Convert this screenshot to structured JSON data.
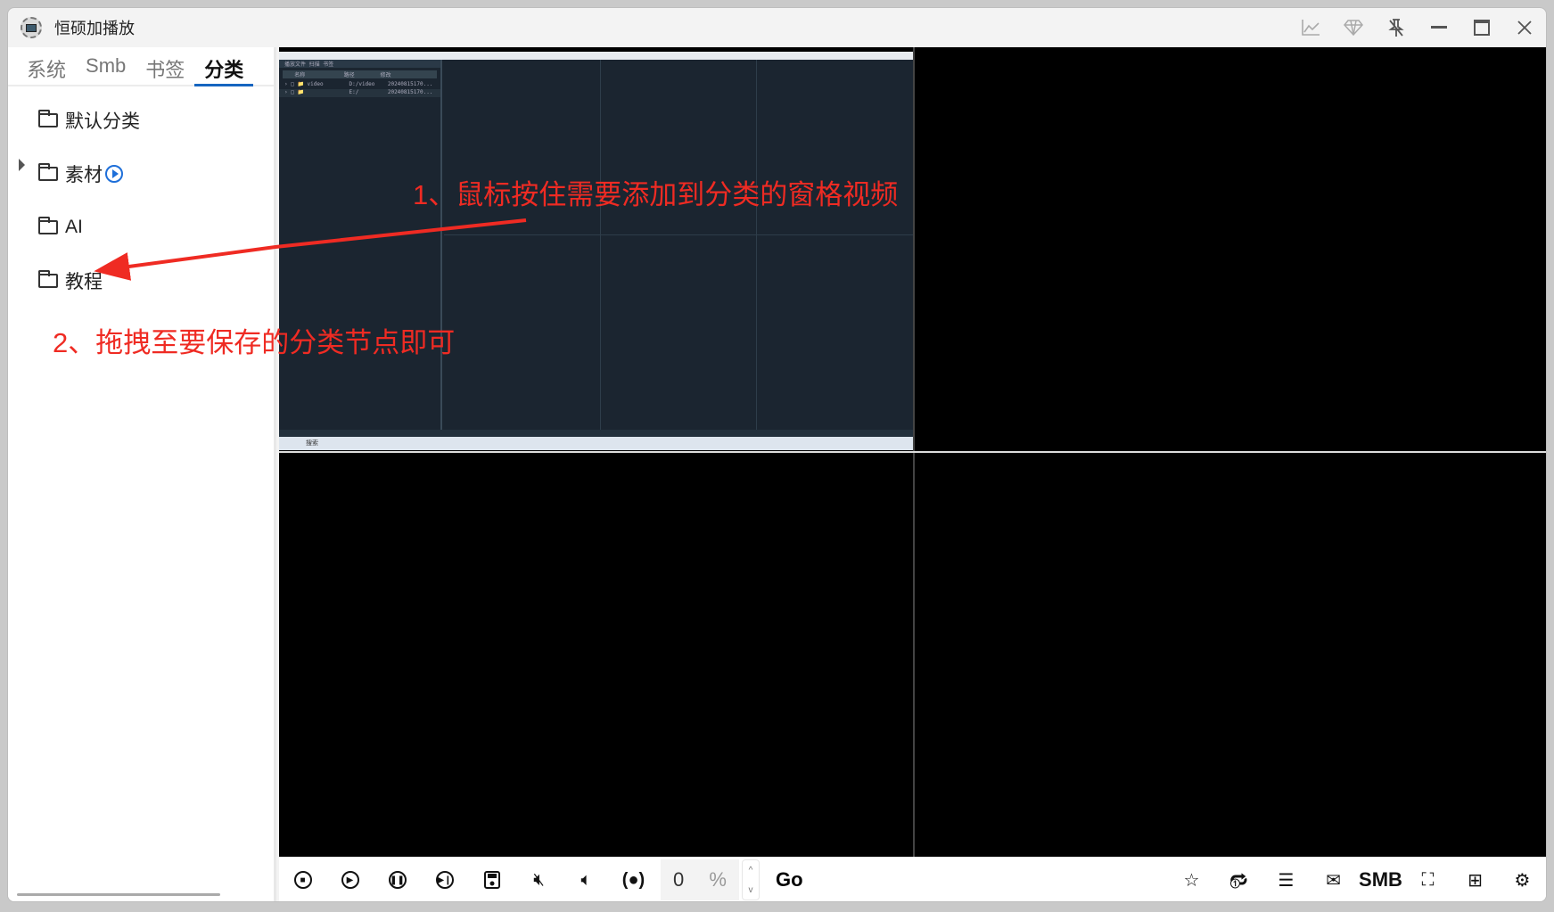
{
  "window": {
    "title": "恒硕加播放",
    "controls": [
      "chart-icon",
      "diamond-icon",
      "unpin-icon",
      "minimize",
      "maximize",
      "close"
    ]
  },
  "sidebar": {
    "tabs": [
      {
        "label": "系统"
      },
      {
        "label": "Smb"
      },
      {
        "label": "书签"
      },
      {
        "label": "分类",
        "active": true
      }
    ],
    "tree": [
      {
        "label": "默认分类"
      },
      {
        "label": "素材",
        "expandable": true,
        "playing": true
      },
      {
        "label": "AI"
      },
      {
        "label": "教程"
      }
    ]
  },
  "embedded": {
    "tabs": "播放文件 扫描 书签",
    "header": "  名称            路径        修改",
    "rows": [
      "› □ 📁 video        D:/video    20240815170...",
      "› □ 📁              E:/         20240815170..."
    ],
    "taskbar": "搜索"
  },
  "annotations": {
    "step1": "1、鼠标按住需要添加到分类的窗格视频",
    "step2": "2、拖拽至要保存的分类节点即可"
  },
  "toolbar": {
    "percent_value": "0",
    "percent_unit": "%",
    "go_label": "Go",
    "smb_label": "SMB",
    "spin_up": "^",
    "spin_down": "v"
  },
  "colors": {
    "accent": "#1565c0",
    "annotation": "#ef2b23",
    "embed_bg": "#1b2530"
  }
}
